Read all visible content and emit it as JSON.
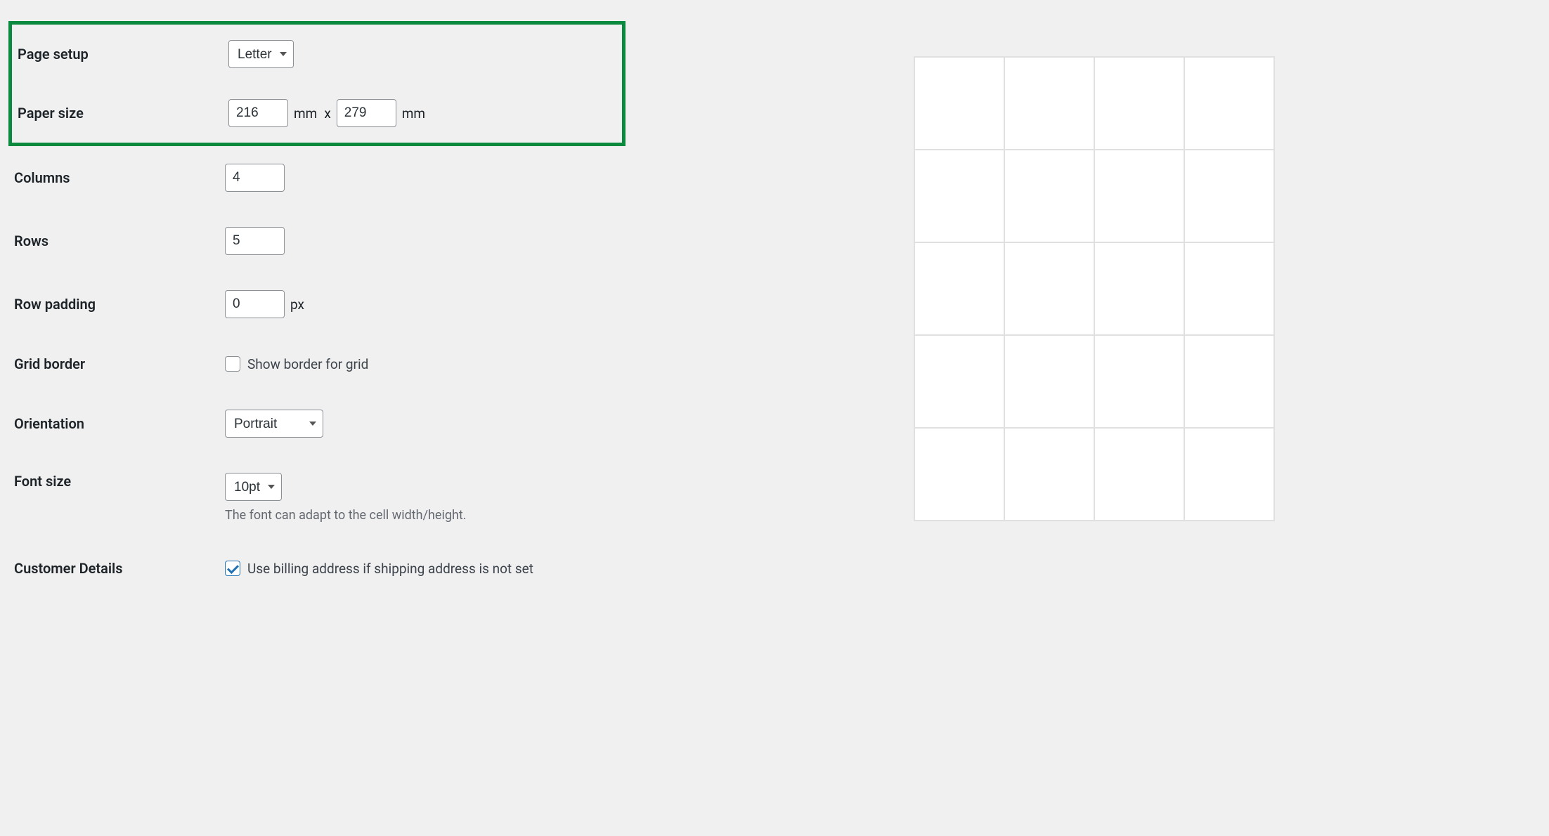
{
  "fields": {
    "page_setup": {
      "label": "Page setup",
      "value": "Letter"
    },
    "paper_size": {
      "label": "Paper size",
      "width": "216",
      "height": "279",
      "unit": "mm",
      "separator": "x"
    },
    "columns": {
      "label": "Columns",
      "value": "4"
    },
    "rows": {
      "label": "Rows",
      "value": "5"
    },
    "row_padding": {
      "label": "Row padding",
      "value": "0",
      "unit": "px"
    },
    "grid_border": {
      "label": "Grid border",
      "checkbox_label": "Show border for grid",
      "checked": false
    },
    "orientation": {
      "label": "Orientation",
      "value": "Portrait"
    },
    "font_size": {
      "label": "Font size",
      "value": "10pt",
      "help": "The font can adapt to the cell width/height."
    },
    "customer_details": {
      "label": "Customer Details",
      "checkbox_label": "Use billing address if shipping address is not set",
      "checked": true
    }
  },
  "preview": {
    "columns": 4,
    "rows": 5
  }
}
